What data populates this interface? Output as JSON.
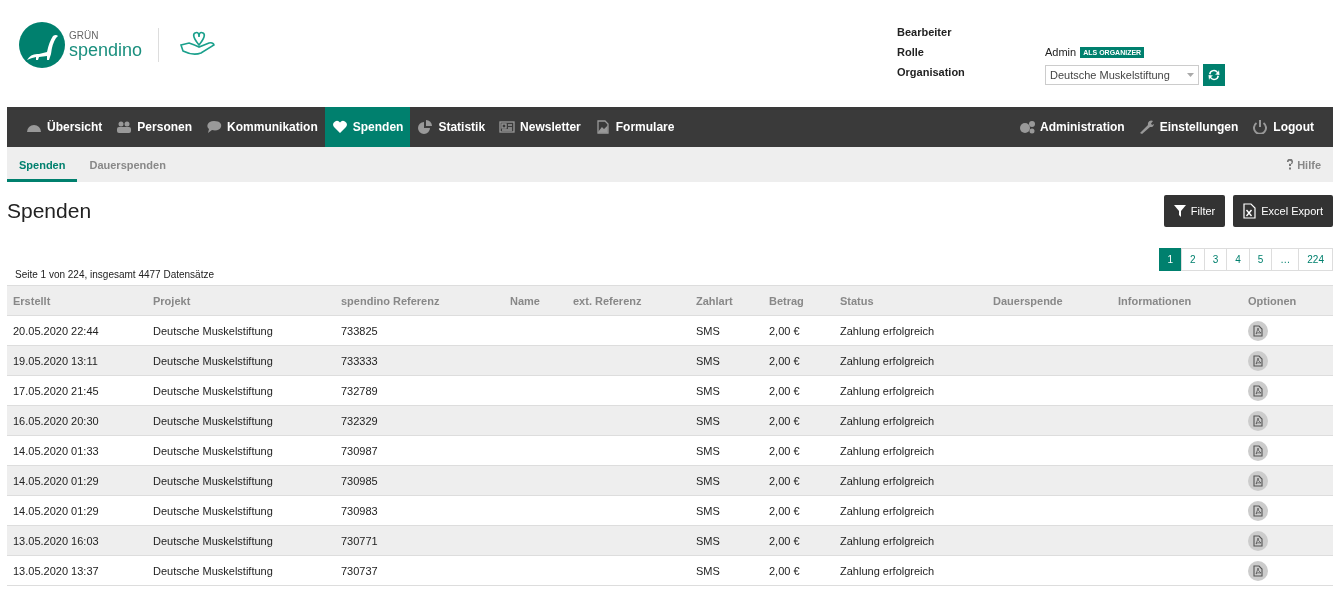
{
  "logo": {
    "top": "GRÜN",
    "name": "spendino"
  },
  "user_info": {
    "labels": [
      "Bearbeiter",
      "Rolle",
      "Organisation"
    ],
    "role": "Admin",
    "role_badge": "ALS ORGANIZER",
    "organisation": "Deutsche Muskelstiftung"
  },
  "nav": {
    "items": [
      {
        "label": "Übersicht",
        "selected": false
      },
      {
        "label": "Personen",
        "selected": false
      },
      {
        "label": "Kommunikation",
        "selected": false
      },
      {
        "label": "Spenden",
        "selected": true
      },
      {
        "label": "Statistik",
        "selected": false
      },
      {
        "label": "Newsletter",
        "selected": false
      },
      {
        "label": "Formulare",
        "selected": false
      }
    ],
    "right_items": [
      {
        "label": "Administration"
      },
      {
        "label": "Einstellungen"
      },
      {
        "label": "Logout"
      }
    ]
  },
  "subtabs": [
    {
      "label": "Spenden",
      "selected": true
    },
    {
      "label": "Dauerspenden",
      "selected": false
    }
  ],
  "help": "Hilfe",
  "title": "Spenden",
  "buttons": [
    "Filter",
    "Excel Export"
  ],
  "pagination": [
    {
      "label": "1",
      "selected": true
    },
    {
      "label": "2",
      "selected": false
    },
    {
      "label": "3",
      "selected": false
    },
    {
      "label": "4",
      "selected": false
    },
    {
      "label": "5",
      "selected": false
    },
    {
      "label": "…",
      "selected": false
    },
    {
      "label": "224",
      "selected": false
    }
  ],
  "summary": "Seite 1 von 224, insgesamt 4477 Datensätze",
  "table": {
    "columns": [
      "Erstellt",
      "Projekt",
      "spendino Referenz",
      "Name",
      "ext. Referenz",
      "Zahlart",
      "Betrag",
      "Status",
      "Dauerspende",
      "Informationen",
      "Optionen"
    ],
    "rows": [
      [
        "20.05.2020 22:44",
        "Deutsche Muskelstiftung",
        "733825",
        "",
        "",
        "SMS",
        "2,00 €",
        "Zahlung erfolgreich",
        "",
        ""
      ],
      [
        "19.05.2020 13:11",
        "Deutsche Muskelstiftung",
        "733333",
        "",
        "",
        "SMS",
        "2,00 €",
        "Zahlung erfolgreich",
        "",
        ""
      ],
      [
        "17.05.2020 21:45",
        "Deutsche Muskelstiftung",
        "732789",
        "",
        "",
        "SMS",
        "2,00 €",
        "Zahlung erfolgreich",
        "",
        ""
      ],
      [
        "16.05.2020 20:30",
        "Deutsche Muskelstiftung",
        "732329",
        "",
        "",
        "SMS",
        "2,00 €",
        "Zahlung erfolgreich",
        "",
        ""
      ],
      [
        "14.05.2020 01:33",
        "Deutsche Muskelstiftung",
        "730987",
        "",
        "",
        "SMS",
        "2,00 €",
        "Zahlung erfolgreich",
        "",
        ""
      ],
      [
        "14.05.2020 01:29",
        "Deutsche Muskelstiftung",
        "730985",
        "",
        "",
        "SMS",
        "2,00 €",
        "Zahlung erfolgreich",
        "",
        ""
      ],
      [
        "14.05.2020 01:29",
        "Deutsche Muskelstiftung",
        "730983",
        "",
        "",
        "SMS",
        "2,00 €",
        "Zahlung erfolgreich",
        "",
        ""
      ],
      [
        "13.05.2020 16:03",
        "Deutsche Muskelstiftung",
        "730771",
        "",
        "",
        "SMS",
        "2,00 €",
        "Zahlung erfolgreich",
        "",
        ""
      ],
      [
        "13.05.2020 13:37",
        "Deutsche Muskelstiftung",
        "730737",
        "",
        "",
        "SMS",
        "2,00 €",
        "Zahlung erfolgreich",
        "",
        ""
      ]
    ]
  }
}
